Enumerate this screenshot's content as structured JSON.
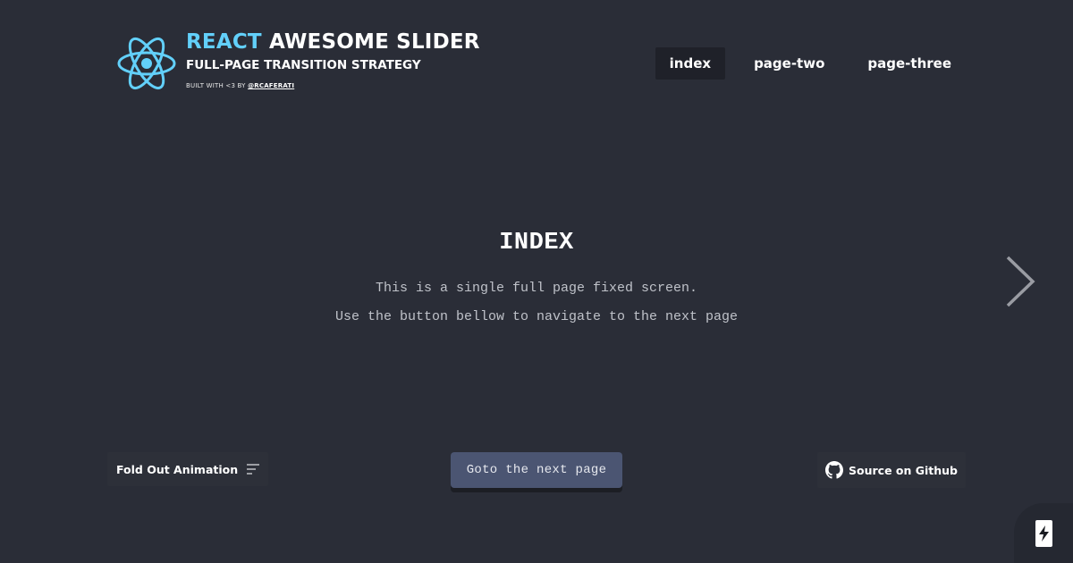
{
  "header": {
    "title_accent": "REACT",
    "title_rest": "AWESOME SLIDER",
    "subtitle": "FULL-PAGE TRANSITION STRATEGY",
    "credit_prefix": "BUILT WITH <3 BY",
    "credit_link": "@RCAFERATI",
    "logo_icon": "react-atom-icon",
    "accent_color": "#62d0fa"
  },
  "nav": {
    "items": [
      {
        "label": "index",
        "active": true
      },
      {
        "label": "page-two",
        "active": false
      },
      {
        "label": "page-three",
        "active": false
      }
    ]
  },
  "main": {
    "title": "INDEX",
    "line1": "This is a single full page fixed screen.",
    "line2": "Use the button bellow to navigate to the next page"
  },
  "controls": {
    "animation_label": "Fold Out Animation",
    "animation_icon": "sort-lines-icon",
    "goto_label": "Goto the next page",
    "github_label": "Source on Github",
    "github_icon": "github-icon",
    "next_icon": "chevron-right-icon",
    "bolt_icon": "lightning-bolt-icon"
  },
  "colors": {
    "background": "#2a2d37",
    "button": "#4b5572",
    "active_nav": "#1f2129"
  }
}
